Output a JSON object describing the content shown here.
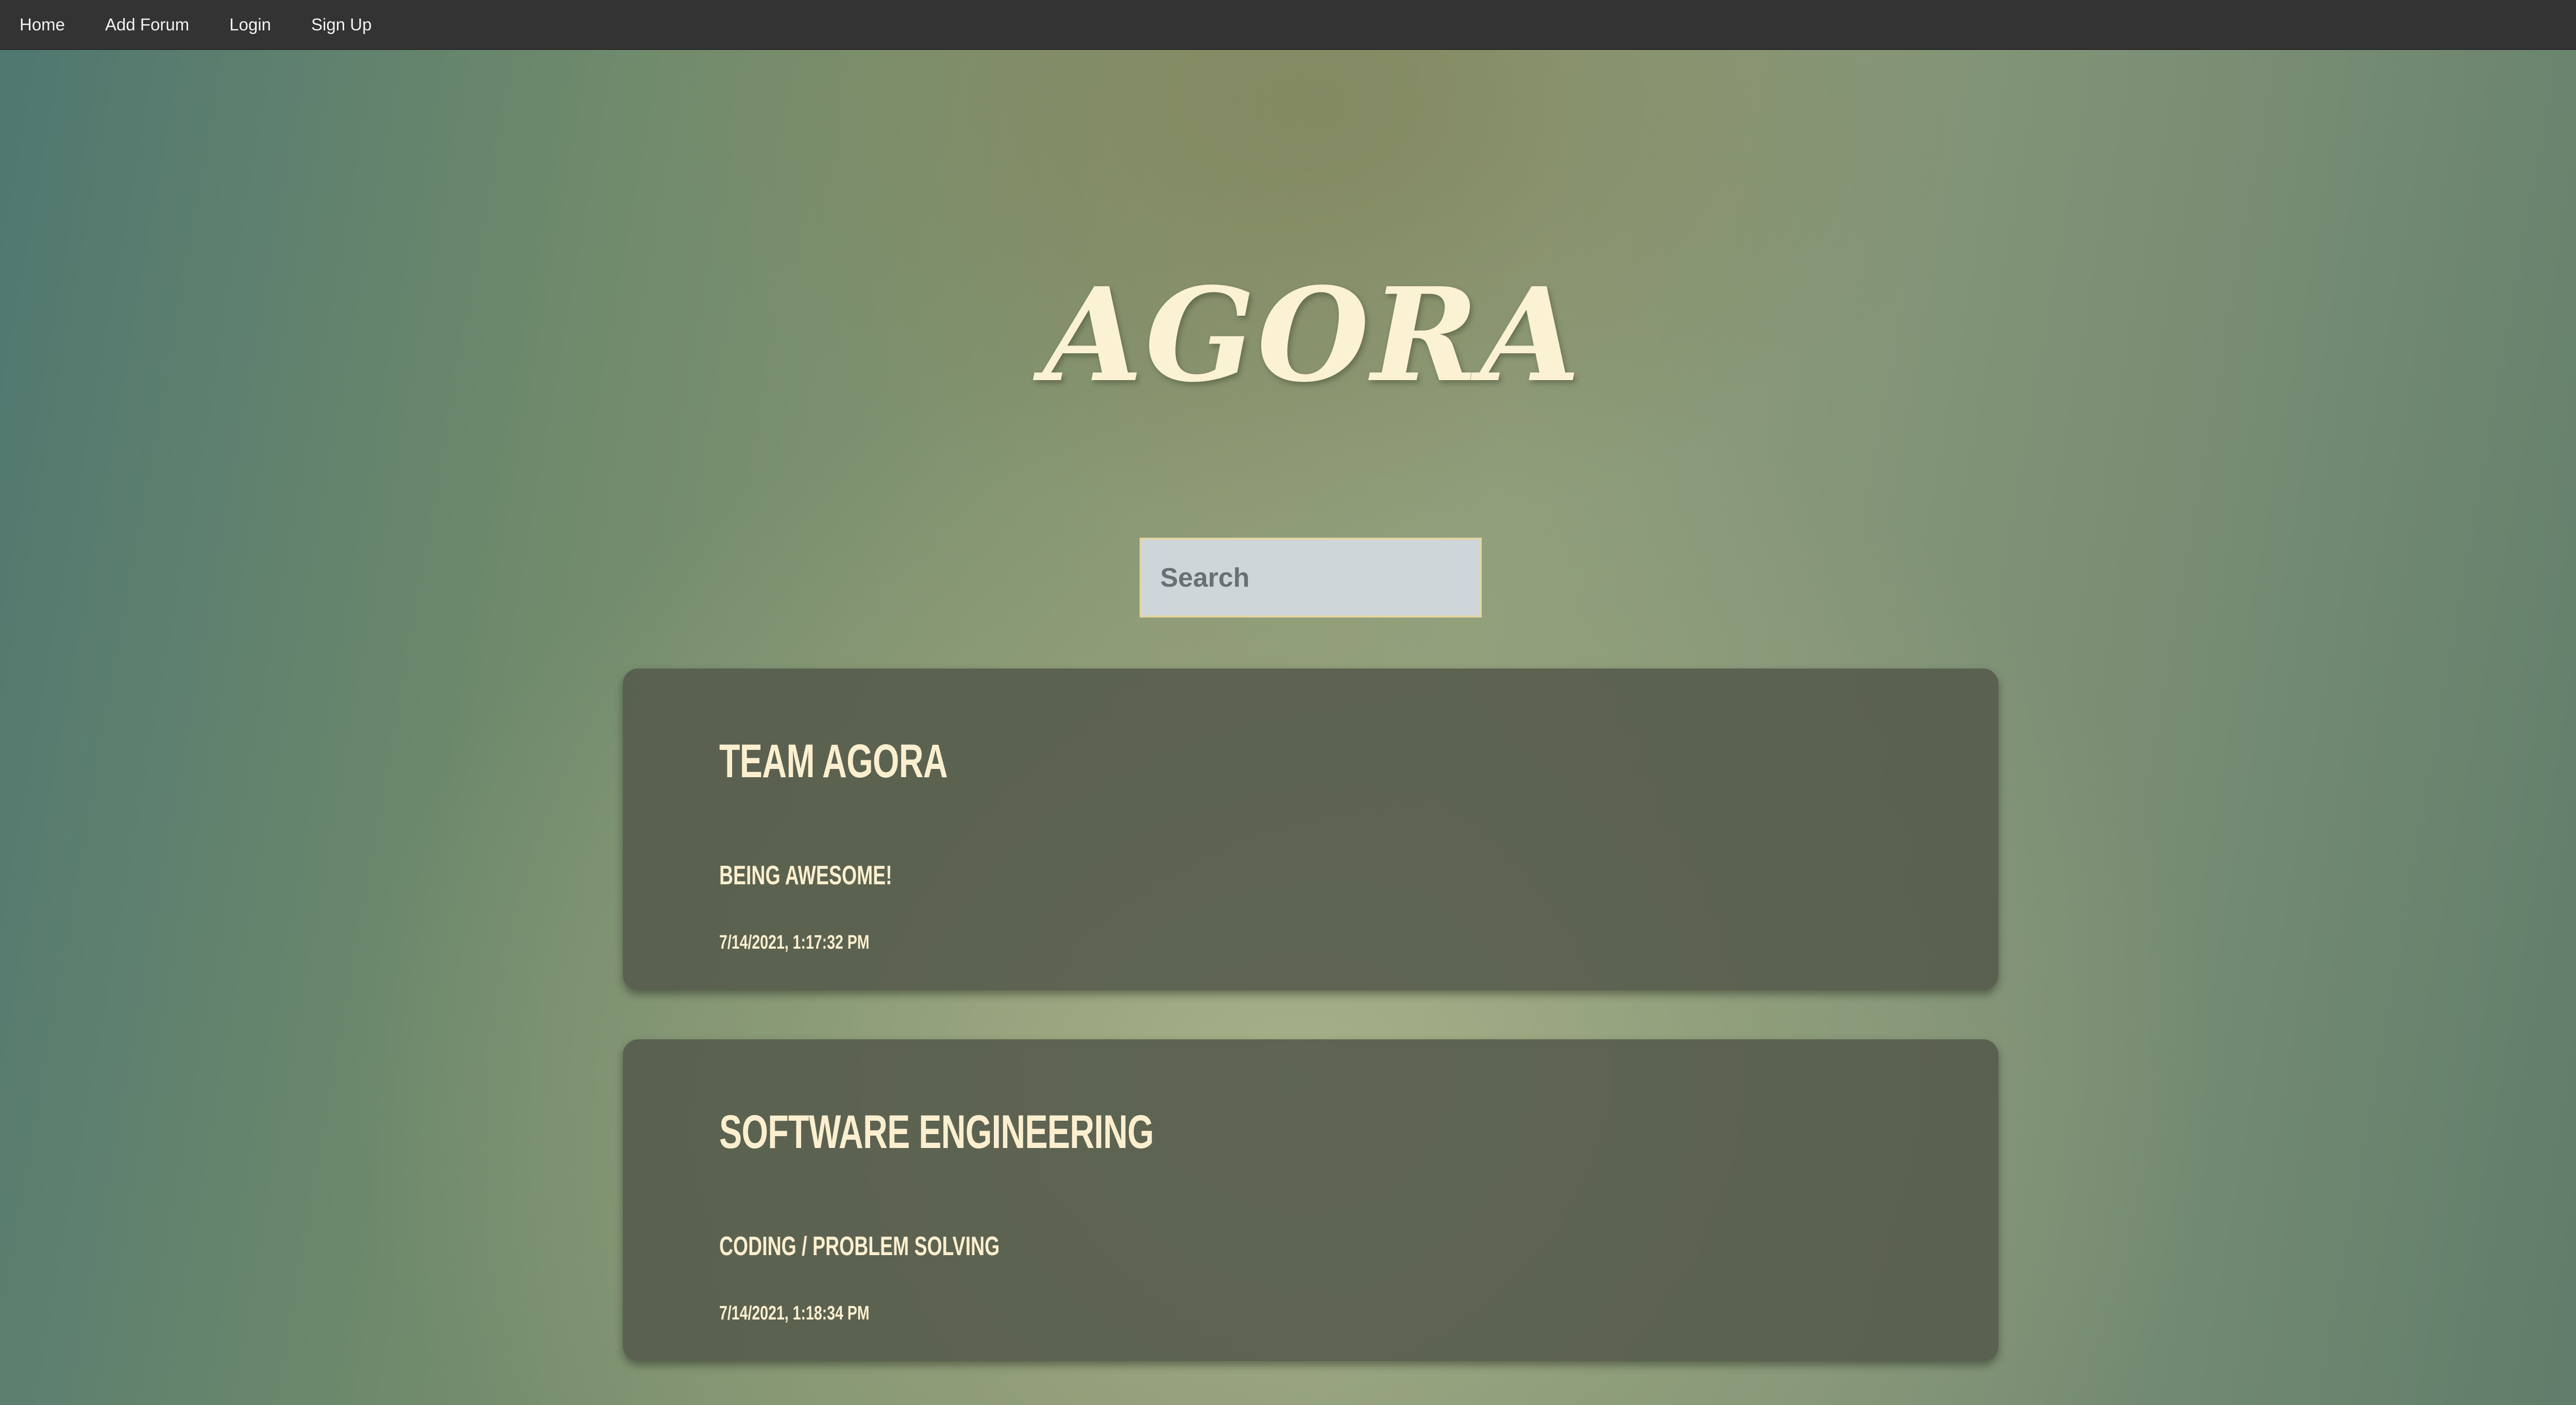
{
  "nav": {
    "items": [
      {
        "label": "Home"
      },
      {
        "label": "Add Forum"
      },
      {
        "label": "Login"
      },
      {
        "label": "Sign Up"
      }
    ]
  },
  "brand": {
    "title": "AGORA"
  },
  "search": {
    "placeholder": "Search",
    "value": ""
  },
  "forums": [
    {
      "title": "TEAM AGORA",
      "description": "BEING AWESOME!",
      "timestamp": "7/14/2021, 1:17:32 PM"
    },
    {
      "title": "SOFTWARE ENGINEERING",
      "description": "CODING / PROBLEM SOLVING",
      "timestamp": "7/14/2021, 1:18:34 PM"
    }
  ],
  "colors": {
    "nav_background": "#333333",
    "accent_text": "#fbefcf",
    "card_background": "#555a4b",
    "search_background": "#cfd6d9",
    "search_border": "#e2d6a4"
  }
}
